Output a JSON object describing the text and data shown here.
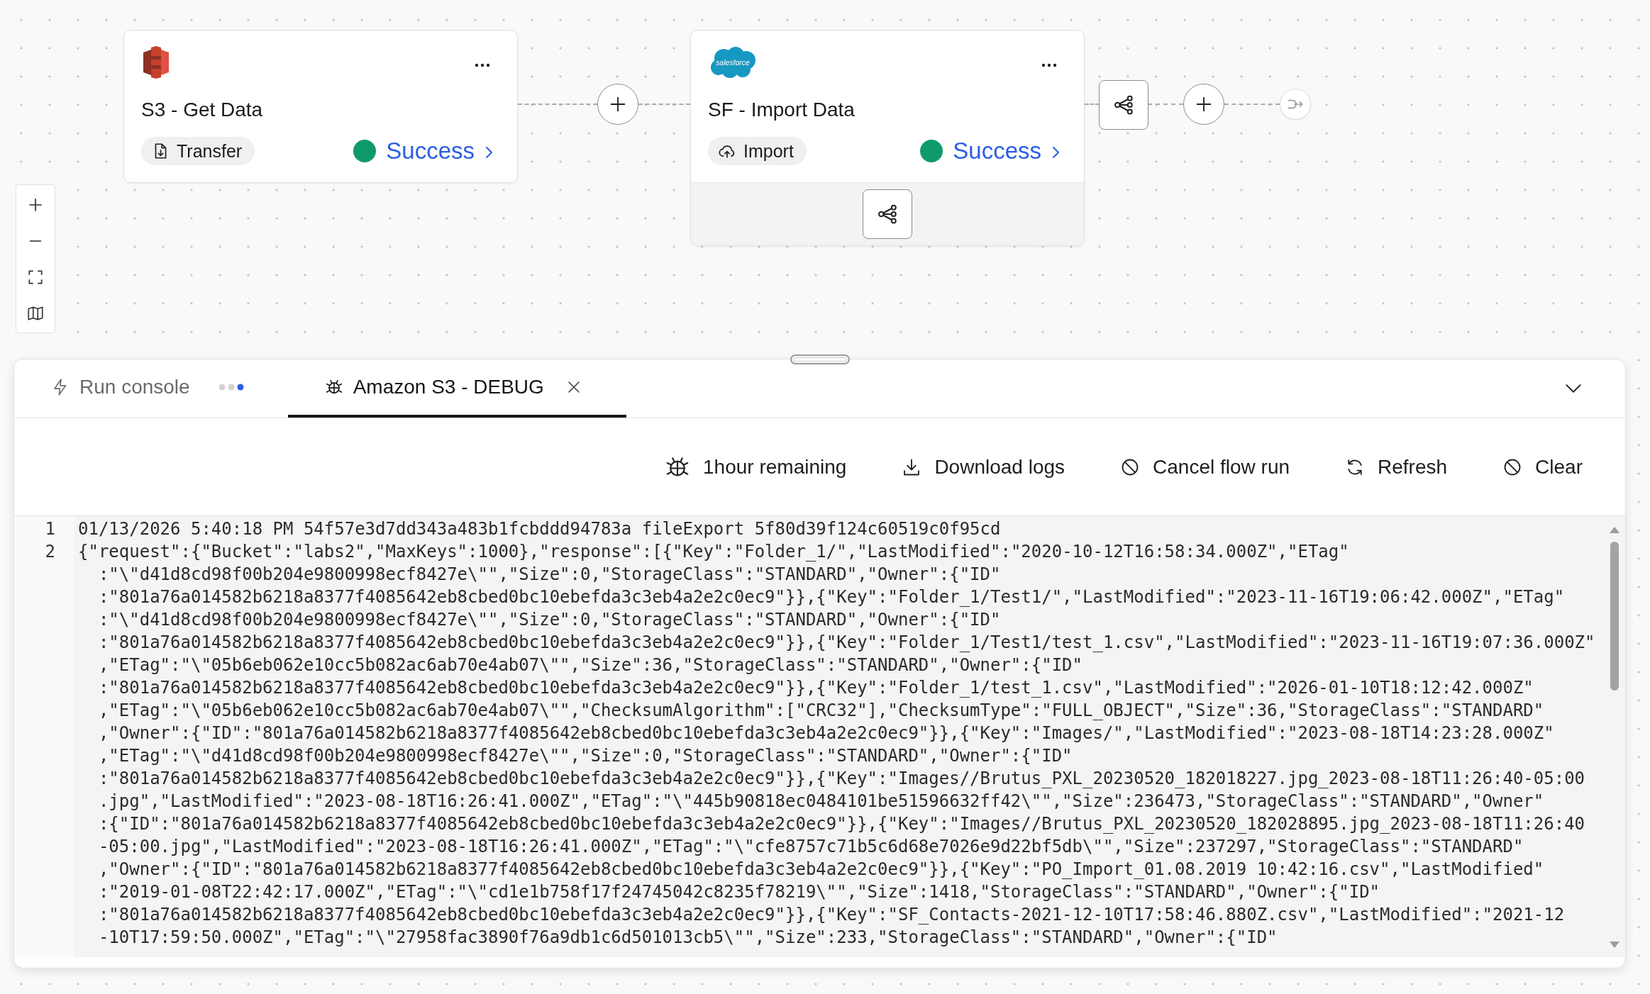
{
  "canvas": {
    "nodes": [
      {
        "kind": "s3",
        "title": "S3 - Get Data",
        "chip": {
          "kind": "transfer",
          "label": "Transfer"
        },
        "status": {
          "kind": "success",
          "label": "Success"
        },
        "footer_action": false
      },
      {
        "kind": "salesforce",
        "logo_text": "salesforce",
        "title": "SF - Import Data",
        "chip": {
          "kind": "import",
          "label": "Import"
        },
        "status": {
          "kind": "success",
          "label": "Success"
        },
        "footer_action": true
      }
    ]
  },
  "console": {
    "tabs": [
      {
        "kind": "console",
        "label": "Run console",
        "selected": false,
        "running": true,
        "closable": false
      },
      {
        "kind": "debug",
        "label": "Amazon S3 - DEBUG",
        "selected": true,
        "running": false,
        "closable": true
      }
    ],
    "toolbar": [
      {
        "kind": "timer",
        "label": "1hour remaining"
      },
      {
        "kind": "download",
        "label": "Download logs"
      },
      {
        "kind": "cancel",
        "label": "Cancel flow run"
      },
      {
        "kind": "refresh",
        "label": "Refresh"
      },
      {
        "kind": "clear",
        "label": "Clear"
      }
    ],
    "log": [
      {
        "number": "1",
        "rows": [
          "01/13/2026 5:40:18 PM 54f57e3d7dd343a483b1fcbddd94783a fileExport 5f80d39f124c60519c0f95cd"
        ]
      },
      {
        "number": "2",
        "rows": [
          "{\"request\":{\"Bucket\":\"labs2\",\"MaxKeys\":1000},\"response\":[{\"Key\":\"Folder_1/\",\"LastModified\":\"2020-10-12T16:58:34.000Z\",\"ETag\"",
          ":\"\\\"d41d8cd98f00b204e9800998ecf8427e\\\"\",\"Size\":0,\"StorageClass\":\"STANDARD\",\"Owner\":{\"ID\"",
          ":\"801a76a014582b6218a8377f4085642eb8cbed0bc10ebefda3c3eb4a2e2c0ec9\"}},{\"Key\":\"Folder_1/Test1/\",\"LastModified\":\"2023-11-16T19:06:42.000Z\",\"ETag\"",
          ":\"\\\"d41d8cd98f00b204e9800998ecf8427e\\\"\",\"Size\":0,\"StorageClass\":\"STANDARD\",\"Owner\":{\"ID\"",
          ":\"801a76a014582b6218a8377f4085642eb8cbed0bc10ebefda3c3eb4a2e2c0ec9\"}},{\"Key\":\"Folder_1/Test1/test_1.csv\",\"LastModified\":\"2023-11-16T19:07:36.000Z\"",
          ",\"ETag\":\"\\\"05b6eb062e10cc5b082ac6ab70e4ab07\\\"\",\"Size\":36,\"StorageClass\":\"STANDARD\",\"Owner\":{\"ID\"",
          ":\"801a76a014582b6218a8377f4085642eb8cbed0bc10ebefda3c3eb4a2e2c0ec9\"}},{\"Key\":\"Folder_1/test_1.csv\",\"LastModified\":\"2026-01-10T18:12:42.000Z\"",
          ",\"ETag\":\"\\\"05b6eb062e10cc5b082ac6ab70e4ab07\\\"\",\"ChecksumAlgorithm\":[\"CRC32\"],\"ChecksumType\":\"FULL_OBJECT\",\"Size\":36,\"StorageClass\":\"STANDARD\"",
          ",\"Owner\":{\"ID\":\"801a76a014582b6218a8377f4085642eb8cbed0bc10ebefda3c3eb4a2e2c0ec9\"}},{\"Key\":\"Images/\",\"LastModified\":\"2023-08-18T14:23:28.000Z\"",
          ",\"ETag\":\"\\\"d41d8cd98f00b204e9800998ecf8427e\\\"\",\"Size\":0,\"StorageClass\":\"STANDARD\",\"Owner\":{\"ID\"",
          ":\"801a76a014582b6218a8377f4085642eb8cbed0bc10ebefda3c3eb4a2e2c0ec9\"}},{\"Key\":\"Images//Brutus_PXL_20230520_182018227.jpg_2023-08-18T11:26:40-05:00",
          ".jpg\",\"LastModified\":\"2023-08-18T16:26:41.000Z\",\"ETag\":\"\\\"445b90818ec0484101be51596632ff42\\\"\",\"Size\":236473,\"StorageClass\":\"STANDARD\",\"Owner\"",
          ":{\"ID\":\"801a76a014582b6218a8377f4085642eb8cbed0bc10ebefda3c3eb4a2e2c0ec9\"}},{\"Key\":\"Images//Brutus_PXL_20230520_182028895.jpg_2023-08-18T11:26:40",
          "-05:00.jpg\",\"LastModified\":\"2023-08-18T16:26:41.000Z\",\"ETag\":\"\\\"cfe8757c71b5c6d68e7026e9d22bf5db\\\"\",\"Size\":237297,\"StorageClass\":\"STANDARD\"",
          ",\"Owner\":{\"ID\":\"801a76a014582b6218a8377f4085642eb8cbed0bc10ebefda3c3eb4a2e2c0ec9\"}},{\"Key\":\"PO_Import_01.08.2019 10:42:16.csv\",\"LastModified\"",
          ":\"2019-01-08T22:42:17.000Z\",\"ETag\":\"\\\"cd1e1b758f17f24745042c8235f78219\\\"\",\"Size\":1418,\"StorageClass\":\"STANDARD\",\"Owner\":{\"ID\"",
          ":\"801a76a014582b6218a8377f4085642eb8cbed0bc10ebefda3c3eb4a2e2c0ec9\"}},{\"Key\":\"SF_Contacts-2021-12-10T17:58:46.880Z.csv\",\"LastModified\":\"2021-12",
          "-10T17:59:50.000Z\",\"ETag\":\"\\\"27958fac3890f76a9db1c6d501013cb5\\\"\",\"Size\":233,\"StorageClass\":\"STANDARD\",\"Owner\":{\"ID\""
        ]
      }
    ]
  }
}
